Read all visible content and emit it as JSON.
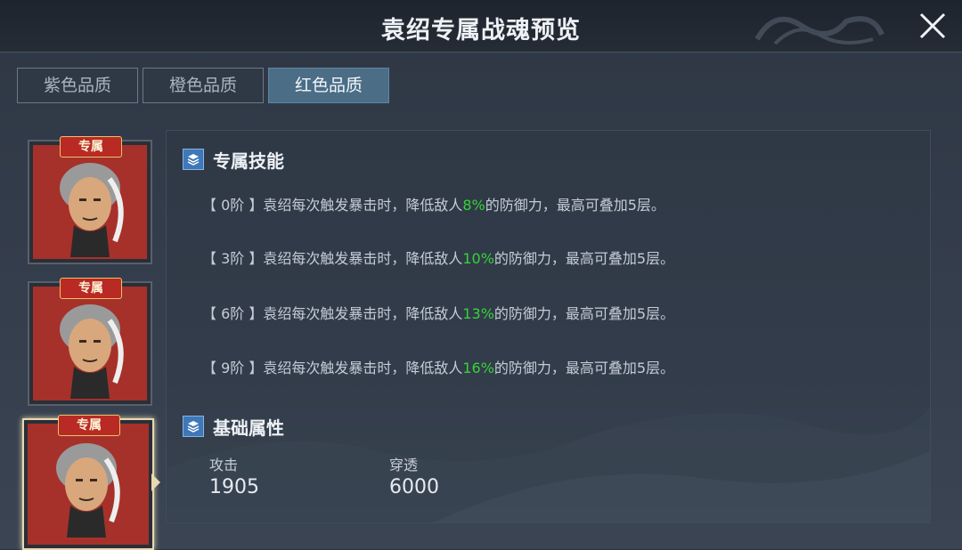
{
  "window": {
    "title": "袁绍专属战魂预览"
  },
  "tabs": [
    {
      "label": "紫色品质",
      "active": false
    },
    {
      "label": "橙色品质",
      "active": false
    },
    {
      "label": "红色品质",
      "active": true
    }
  ],
  "portraits": [
    {
      "badge": "专属",
      "selected": false
    },
    {
      "badge": "专属",
      "selected": false
    },
    {
      "badge": "专属",
      "selected": true
    }
  ],
  "skill_section": {
    "title": "专属技能",
    "lines": [
      {
        "prefix": "【 0阶 】袁绍每次触发暴击时，降低敌人",
        "value": "8%",
        "suffix": "的防御力，最高可叠加5层。"
      },
      {
        "prefix": "【 3阶 】袁绍每次触发暴击时，降低敌人",
        "value": "10%",
        "suffix": "的防御力，最高可叠加5层。"
      },
      {
        "prefix": "【 6阶 】袁绍每次触发暴击时，降低敌人",
        "value": "13%",
        "suffix": "的防御力，最高可叠加5层。"
      },
      {
        "prefix": "【 9阶 】袁绍每次触发暴击时，降低敌人",
        "value": "16%",
        "suffix": "的防御力，最高可叠加5层。"
      }
    ]
  },
  "attr_section": {
    "title": "基础属性",
    "stats": [
      {
        "label": "攻击",
        "value": "1905"
      },
      {
        "label": "穿透",
        "value": "6000"
      }
    ]
  },
  "colors": {
    "accent_tab": "#4b6d86",
    "highlight_green": "#37d23a",
    "badge_red": "#b82a23"
  },
  "icons": {
    "close": "close-icon",
    "section": "layers-icon"
  }
}
